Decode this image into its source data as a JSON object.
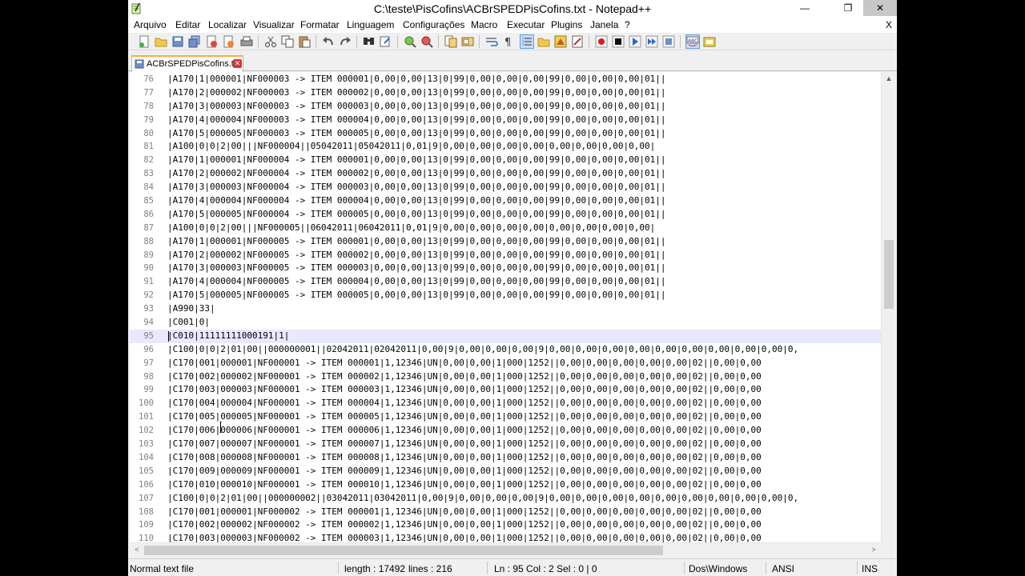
{
  "window": {
    "title": "C:\\teste\\PisCofins\\ACBrSPEDPisCofins.txt - Notepad++",
    "minimize_glyph": "—",
    "maximize_glyph": "❐",
    "close_glyph": "✕"
  },
  "menu": {
    "items": [
      "Arquivo",
      "Editar",
      "Localizar",
      "Visualizar",
      "Formatar",
      "Linguagem",
      "Configurações",
      "Macro",
      "Executar",
      "Plugins",
      "Janela",
      "?"
    ],
    "close_glyph": "X"
  },
  "toolbar": {
    "icons": [
      "new-file-icon",
      "open-file-icon",
      "save-icon",
      "save-all-icon",
      "close-icon",
      "close-all-icon",
      "print-icon",
      "cut-icon",
      "copy-icon",
      "paste-icon",
      "undo-icon",
      "redo-icon",
      "find-icon",
      "replace-icon",
      "zoom-in-icon",
      "zoom-out-icon",
      "sync-vertical-icon",
      "sync-horizontal-icon",
      "word-wrap-icon",
      "show-all-chars-icon",
      "indent-guide-icon",
      "folder-as-workspace-icon",
      "document-map-icon",
      "function-list-icon",
      "record-macro-icon",
      "stop-macro-icon",
      "play-macro-icon",
      "run-macro-multiple-icon",
      "save-macro-icon",
      "spell-check-icon",
      "plugin-icon"
    ]
  },
  "tab": {
    "label": "ACBrSPEDPisCofins.txt",
    "close_glyph": "✕"
  },
  "editor": {
    "current_line": 95,
    "lines": [
      {
        "n": "76",
        "t": "|A170|1|000001|NF000003 -> ITEM 000001|0,00|0,00|13|0|99|0,00|0,00|0,00|99|0,00|0,00|0,00|01||"
      },
      {
        "n": "77",
        "t": "|A170|2|000002|NF000003 -> ITEM 000002|0,00|0,00|13|0|99|0,00|0,00|0,00|99|0,00|0,00|0,00|01||"
      },
      {
        "n": "78",
        "t": "|A170|3|000003|NF000003 -> ITEM 000003|0,00|0,00|13|0|99|0,00|0,00|0,00|99|0,00|0,00|0,00|01||"
      },
      {
        "n": "79",
        "t": "|A170|4|000004|NF000003 -> ITEM 000004|0,00|0,00|13|0|99|0,00|0,00|0,00|99|0,00|0,00|0,00|01||"
      },
      {
        "n": "80",
        "t": "|A170|5|000005|NF000003 -> ITEM 000005|0,00|0,00|13|0|99|0,00|0,00|0,00|99|0,00|0,00|0,00|01||"
      },
      {
        "n": "81",
        "t": "|A100|0|0|2|00|||NF000004||05042011|05042011|0,01|9|0,00|0,00|0,00|0,00|0,00|0,00|0,00|0,00|"
      },
      {
        "n": "82",
        "t": "|A170|1|000001|NF000004 -> ITEM 000001|0,00|0,00|13|0|99|0,00|0,00|0,00|99|0,00|0,00|0,00|01||"
      },
      {
        "n": "83",
        "t": "|A170|2|000002|NF000004 -> ITEM 000002|0,00|0,00|13|0|99|0,00|0,00|0,00|99|0,00|0,00|0,00|01||"
      },
      {
        "n": "84",
        "t": "|A170|3|000003|NF000004 -> ITEM 000003|0,00|0,00|13|0|99|0,00|0,00|0,00|99|0,00|0,00|0,00|01||"
      },
      {
        "n": "85",
        "t": "|A170|4|000004|NF000004 -> ITEM 000004|0,00|0,00|13|0|99|0,00|0,00|0,00|99|0,00|0,00|0,00|01||"
      },
      {
        "n": "86",
        "t": "|A170|5|000005|NF000004 -> ITEM 000005|0,00|0,00|13|0|99|0,00|0,00|0,00|99|0,00|0,00|0,00|01||"
      },
      {
        "n": "87",
        "t": "|A100|0|0|2|00|||NF000005||06042011|06042011|0,01|9|0,00|0,00|0,00|0,00|0,00|0,00|0,00|0,00|"
      },
      {
        "n": "88",
        "t": "|A170|1|000001|NF000005 -> ITEM 000001|0,00|0,00|13|0|99|0,00|0,00|0,00|99|0,00|0,00|0,00|01||"
      },
      {
        "n": "89",
        "t": "|A170|2|000002|NF000005 -> ITEM 000002|0,00|0,00|13|0|99|0,00|0,00|0,00|99|0,00|0,00|0,00|01||"
      },
      {
        "n": "90",
        "t": "|A170|3|000003|NF000005 -> ITEM 000003|0,00|0,00|13|0|99|0,00|0,00|0,00|99|0,00|0,00|0,00|01||"
      },
      {
        "n": "91",
        "t": "|A170|4|000004|NF000005 -> ITEM 000004|0,00|0,00|13|0|99|0,00|0,00|0,00|99|0,00|0,00|0,00|01||"
      },
      {
        "n": "92",
        "t": "|A170|5|000005|NF000005 -> ITEM 000005|0,00|0,00|13|0|99|0,00|0,00|0,00|99|0,00|0,00|0,00|01||"
      },
      {
        "n": "93",
        "t": "|A990|33|"
      },
      {
        "n": "94",
        "t": "|C001|0|"
      },
      {
        "n": "95",
        "t": "|C010|11111111000191|1|"
      },
      {
        "n": "96",
        "t": "|C100|0|0|2|01|00||000000001||02042011|02042011|0,00|9|0,00|0,00|0,00|9|0,00|0,00|0,00|0,00|0,00|0,00|0,00|0,00|0,00|0,"
      },
      {
        "n": "97",
        "t": "|C170|001|000001|NF000001 -> ITEM 000001|1,12346|UN|0,00|0,00|1|000|1252||0,00|0,00|0,00|0,00|0,00|02||0,00|0,00"
      },
      {
        "n": "98",
        "t": "|C170|002|000002|NF000001 -> ITEM 000002|1,12346|UN|0,00|0,00|1|000|1252||0,00|0,00|0,00|0,00|0,00|02||0,00|0,00"
      },
      {
        "n": "99",
        "t": "|C170|003|000003|NF000001 -> ITEM 000003|1,12346|UN|0,00|0,00|1|000|1252||0,00|0,00|0,00|0,00|0,00|02||0,00|0,00"
      },
      {
        "n": "100",
        "t": "|C170|004|000004|NF000001 -> ITEM 000004|1,12346|UN|0,00|0,00|1|000|1252||0,00|0,00|0,00|0,00|0,00|02||0,00|0,00"
      },
      {
        "n": "101",
        "t": "|C170|005|000005|NF000001 -> ITEM 000005|1,12346|UN|0,00|0,00|1|000|1252||0,00|0,00|0,00|0,00|0,00|02||0,00|0,00"
      },
      {
        "n": "102",
        "t": "|C170|006|000006|NF000001 -> ITEM 000006|1,12346|UN|0,00|0,00|1|000|1252||0,00|0,00|0,00|0,00|0,00|02||0,00|0,00"
      },
      {
        "n": "103",
        "t": "|C170|007|000007|NF000001 -> ITEM 000007|1,12346|UN|0,00|0,00|1|000|1252||0,00|0,00|0,00|0,00|0,00|02||0,00|0,00"
      },
      {
        "n": "104",
        "t": "|C170|008|000008|NF000001 -> ITEM 000008|1,12346|UN|0,00|0,00|1|000|1252||0,00|0,00|0,00|0,00|0,00|02||0,00|0,00"
      },
      {
        "n": "105",
        "t": "|C170|009|000009|NF000001 -> ITEM 000009|1,12346|UN|0,00|0,00|1|000|1252||0,00|0,00|0,00|0,00|0,00|02||0,00|0,00"
      },
      {
        "n": "106",
        "t": "|C170|010|000010|NF000001 -> ITEM 000010|1,12346|UN|0,00|0,00|1|000|1252||0,00|0,00|0,00|0,00|0,00|02||0,00|0,00"
      },
      {
        "n": "107",
        "t": "|C100|0|0|2|01|00||000000002||03042011|03042011|0,00|9|0,00|0,00|0,00|9|0,00|0,00|0,00|0,00|0,00|0,00|0,00|0,00|0,00|0,"
      },
      {
        "n": "108",
        "t": "|C170|001|000001|NF000002 -> ITEM 000001|1,12346|UN|0,00|0,00|1|000|1252||0,00|0,00|0,00|0,00|0,00|02||0,00|0,00"
      },
      {
        "n": "109",
        "t": "|C170|002|000002|NF000002 -> ITEM 000002|1,12346|UN|0,00|0,00|1|000|1252||0,00|0,00|0,00|0,00|0,00|02||0,00|0,00"
      },
      {
        "n": "110",
        "t": "|C170|003|000003|NF000002 -> ITEM 000003|1,12346|UN|0,00|0,00|1|000|1252||0,00|0,00|0,00|0,00|0,00|02||0,00|0,00"
      }
    ]
  },
  "scroll": {
    "up_glyph": "▲",
    "left_glyph": "<",
    "right_glyph": ">"
  },
  "status": {
    "file_type": "Normal text file",
    "length": "length : 17492",
    "lines": "lines : 216",
    "position": "Ln : 95   Col : 2   Sel : 0 | 0",
    "eol": "Dos\\Windows",
    "encoding": "ANSI",
    "mode": "INS"
  },
  "colors": {
    "current_line_bg": "#e8e8ff",
    "tab_accent": "#f9ad3e",
    "line_number": "#808080"
  }
}
